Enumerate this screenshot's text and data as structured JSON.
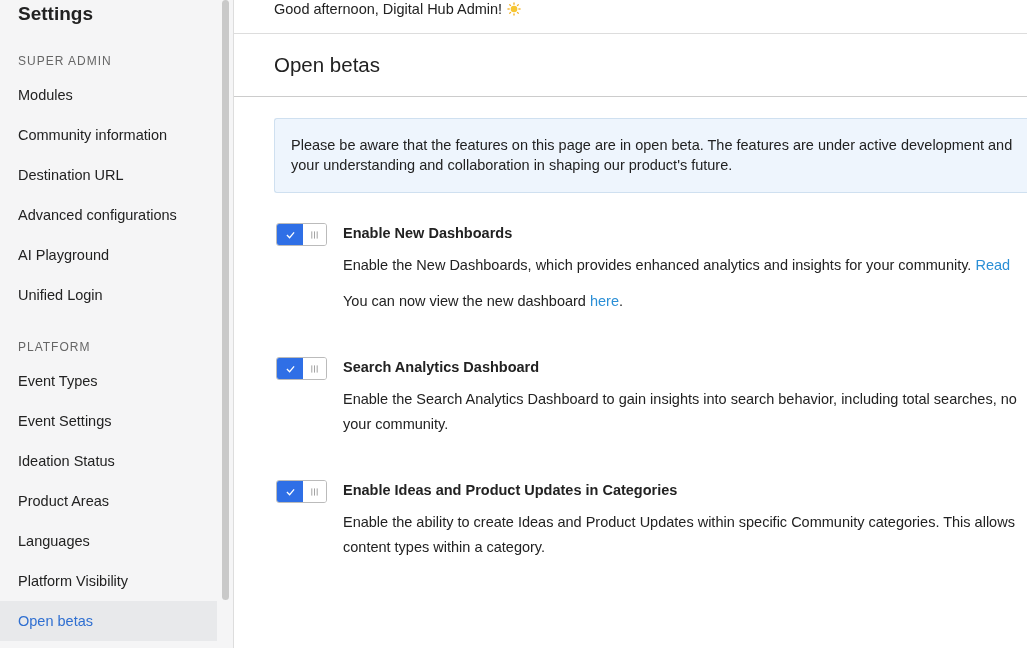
{
  "sidebar": {
    "title": "Settings",
    "sections": [
      {
        "label": "SUPER ADMIN",
        "items": [
          {
            "label": "Modules",
            "selected": false
          },
          {
            "label": "Community information",
            "selected": false
          },
          {
            "label": "Destination URL",
            "selected": false
          },
          {
            "label": "Advanced configurations",
            "selected": false
          },
          {
            "label": "AI Playground",
            "selected": false
          },
          {
            "label": "Unified Login",
            "selected": false
          }
        ]
      },
      {
        "label": "PLATFORM",
        "items": [
          {
            "label": "Event Types",
            "selected": false
          },
          {
            "label": "Event Settings",
            "selected": false
          },
          {
            "label": "Ideation Status",
            "selected": false
          },
          {
            "label": "Product Areas",
            "selected": false
          },
          {
            "label": "Languages",
            "selected": false
          },
          {
            "label": "Platform Visibility",
            "selected": false
          },
          {
            "label": "Open betas",
            "selected": true
          }
        ]
      }
    ]
  },
  "greeting": "Good afternoon, Digital Hub Admin!",
  "page_title": "Open betas",
  "notice": [
    "Please be aware that the features on this page are in open beta. The features are under active development and",
    "your understanding and collaboration in shaping our product's future."
  ],
  "features": [
    {
      "title": "Enable New Dashboards",
      "on": true,
      "paragraphs": [
        {
          "lines": [
            "Enable the New Dashboards, which provides enhanced analytics and insights for your community."
          ],
          "link": "Read"
        },
        {
          "lines": [
            "You can now view the new dashboard"
          ],
          "link": "here",
          "after": "."
        }
      ]
    },
    {
      "title": "Search Analytics Dashboard",
      "on": true,
      "paragraphs": [
        {
          "lines": [
            "Enable the Search Analytics Dashboard to gain insights into search behavior, including total searches, no",
            "your community."
          ]
        }
      ]
    },
    {
      "title": "Enable Ideas and Product Updates in Categories",
      "on": true,
      "paragraphs": [
        {
          "lines": [
            "Enable the ability to create Ideas and Product Updates within specific Community categories. This allows",
            "content types within a category."
          ]
        }
      ]
    }
  ]
}
